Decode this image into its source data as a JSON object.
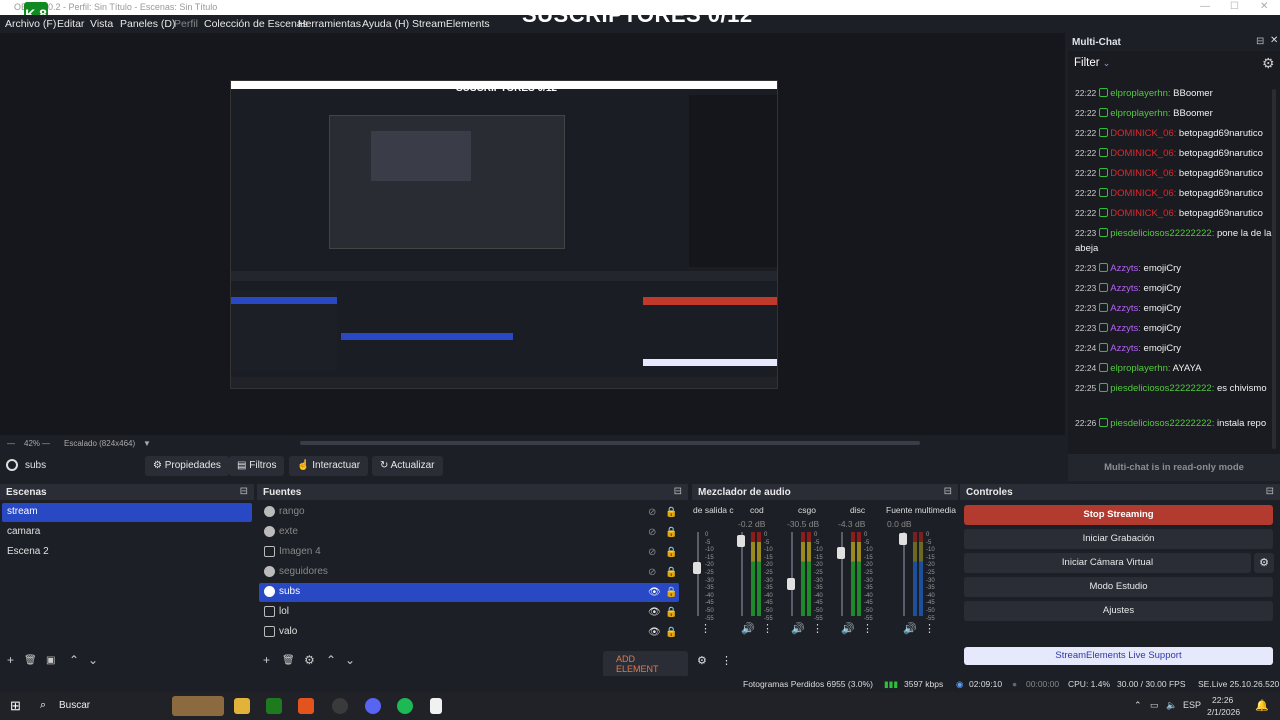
{
  "titlebar": {
    "title": "OBS 32.0.2 - Perfil: Sin Título - Escenas: Sin Título",
    "logo_text": "K 8"
  },
  "overlay_title": "SUSCRIPTORES 0/12",
  "menu": [
    {
      "label": "Archivo (F)",
      "dim": false
    },
    {
      "label": "Editar",
      "dim": false
    },
    {
      "label": "Vista",
      "dim": false
    },
    {
      "label": "Paneles (D)",
      "dim": false
    },
    {
      "label": "Perfil",
      "dim": true
    },
    {
      "label": "Colección de Escenas",
      "dim": false
    },
    {
      "label": "Herramientas",
      "dim": false
    },
    {
      "label": "Ayuda (H)",
      "dim": false
    },
    {
      "label": "StreamElements",
      "dim": false
    }
  ],
  "preview": {
    "zoom": "42%",
    "scale": "Escalado (824x464)"
  },
  "source_toolbar": {
    "current": "subs",
    "properties": "Propiedades",
    "filters": "Filtros",
    "interact": "Interactuar",
    "refresh": "Actualizar"
  },
  "scenes": {
    "title": "Escenas",
    "items": [
      {
        "label": "stream",
        "selected": true
      },
      {
        "label": "camara",
        "selected": false
      },
      {
        "label": "Escena 2",
        "selected": false
      }
    ]
  },
  "sources": {
    "title": "Fuentes",
    "add_element": "ADD ELEMENT",
    "items": [
      {
        "label": "rango",
        "hidden": true,
        "selected": false,
        "icon": "globe-icon"
      },
      {
        "label": "exte",
        "hidden": true,
        "selected": false,
        "icon": "globe-icon"
      },
      {
        "label": "Imagen 4",
        "hidden": true,
        "selected": false,
        "icon": "image-icon"
      },
      {
        "label": "seguidores",
        "hidden": true,
        "selected": false,
        "icon": "globe-icon"
      },
      {
        "label": "subs",
        "hidden": false,
        "selected": true,
        "icon": "globe-icon"
      },
      {
        "label": "lol",
        "hidden": false,
        "selected": false,
        "icon": "game-capture-icon"
      },
      {
        "label": "valo",
        "hidden": false,
        "selected": false,
        "icon": "game-capture-icon"
      }
    ]
  },
  "mixer": {
    "title": "Mezclador de audio",
    "channels": [
      {
        "name": "de salida c",
        "db": "",
        "level": 0.55
      },
      {
        "name": "cod",
        "db": "-0.2 dB",
        "level": 0.95
      },
      {
        "name": "csgo",
        "db": "-30.5 dB",
        "level": 0.45
      },
      {
        "name": "disc",
        "db": "-4.3 dB",
        "level": 0.8
      },
      {
        "name": "Fuente multimedia",
        "db": "0.0 dB",
        "level": 1.0
      }
    ],
    "scale": [
      "0",
      "-5",
      "-10",
      "-15",
      "-20",
      "-25",
      "-30",
      "-35",
      "-40",
      "-45",
      "-50",
      "-55",
      "-60"
    ]
  },
  "controls": {
    "title": "Controles",
    "stop_streaming": "Stop Streaming",
    "start_recording": "Iniciar Grabación",
    "virtual_cam": "Iniciar Cámara Virtual",
    "studio_mode": "Modo Estudio",
    "settings": "Ajustes",
    "support": "StreamElements Live Support"
  },
  "multichat": {
    "title": "Multi-Chat",
    "filter": "Filter",
    "readonly": "Multi-chat is in read-only mode",
    "messages": [
      {
        "time": "22:22",
        "user": "elproplayerhn:",
        "color": "green",
        "text": "BBoomer"
      },
      {
        "time": "22:22",
        "user": "elproplayerhn:",
        "color": "green",
        "text": "BBoomer"
      },
      {
        "time": "22:22",
        "user": "DOMINICK_06:",
        "color": "red",
        "text": "betopagd69narutico"
      },
      {
        "time": "22:22",
        "user": "DOMINICK_06:",
        "color": "red",
        "text": "betopagd69narutico"
      },
      {
        "time": "22:22",
        "user": "DOMINICK_06:",
        "color": "red",
        "text": "betopagd69narutico"
      },
      {
        "time": "22:22",
        "user": "DOMINICK_06:",
        "color": "red",
        "text": "betopagd69narutico"
      },
      {
        "time": "22:22",
        "user": "DOMINICK_06:",
        "color": "red",
        "text": "betopagd69narutico"
      },
      {
        "time": "22:23",
        "user": "piesdeliciosos22222222:",
        "color": "green",
        "text": "pone la de la abeja"
      },
      {
        "time": "22:23",
        "user": "Azzyts:",
        "color": "purple",
        "text": "emojiCry"
      },
      {
        "time": "22:23",
        "user": "Azzyts:",
        "color": "purple",
        "text": "emojiCry"
      },
      {
        "time": "22:23",
        "user": "Azzyts:",
        "color": "purple",
        "text": "emojiCry"
      },
      {
        "time": "22:23",
        "user": "Azzyts:",
        "color": "purple",
        "text": "emojiCry"
      },
      {
        "time": "22:24",
        "user": "Azzyts:",
        "color": "purple",
        "text": "emojiCry"
      },
      {
        "time": "22:24",
        "user": "elproplayerhn:",
        "color": "green",
        "text": "AYAYA"
      },
      {
        "time": "22:25",
        "user": "piesdeliciosos22222222:",
        "color": "green",
        "text": "es chivismo"
      },
      {
        "time": "22:26",
        "user": "piesdeliciosos22222222:",
        "color": "green",
        "text": "instala repo"
      }
    ]
  },
  "status": {
    "dropped": "Fotogramas Perdidos 6955 (3.0%)",
    "bitrate": "3597 kbps",
    "stream_time": "02:09:10",
    "rec_time": "00:00:00",
    "cpu": "CPU: 1.4%",
    "fps": "30.00 / 30.00 FPS",
    "se_live": "SE.Live 25.10.26.520"
  },
  "taskbar": {
    "search": "Buscar",
    "lang": "ESP",
    "time": "22:26",
    "date": "2/1/2026"
  }
}
